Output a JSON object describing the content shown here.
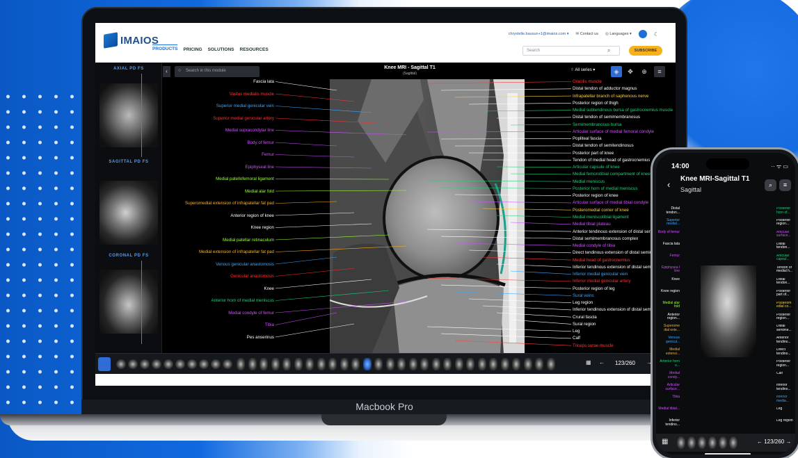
{
  "device": {
    "laptop_label": "Macbook Pro"
  },
  "header": {
    "logo": "IMAIOS",
    "nav": [
      "PRODUCTS",
      "PRICING",
      "SOLUTIONS",
      "RESOURCES"
    ],
    "account_email": "chrystelle.bausun+1@imaios.com ▾",
    "contact": "Contact us",
    "languages": "Languages ▾",
    "search_placeholder": "Search",
    "subscribe": "SUBSCRIBE"
  },
  "rail": {
    "series": [
      {
        "title": "AXIAL PD FS"
      },
      {
        "title": "SAGITTAL PD FS"
      },
      {
        "title": "CORONAL PD FS"
      }
    ]
  },
  "viewer": {
    "module_search_placeholder": "Search in this module",
    "title": "Knee MRI - Sagittal T1",
    "subtitle": "(Sagittal)",
    "series_selector": "All series ▾",
    "counter": "123/260",
    "labels_left": [
      {
        "text": "Fascia lata",
        "color": "#ffffff"
      },
      {
        "text": "Vastus medialis muscle",
        "color": "#ff3b3b"
      },
      {
        "text": "Superior medial genicular vein",
        "color": "#3aa8ff"
      },
      {
        "text": "Superior medial genicular artery",
        "color": "#ff3030"
      },
      {
        "text": "Medial supracondylar line",
        "color": "#d052ff"
      },
      {
        "text": "Body of femur",
        "color": "#d052ff"
      },
      {
        "text": "Femur",
        "color": "#d052ff"
      },
      {
        "text": "Epiphyseal line",
        "color": "#d052ff"
      },
      {
        "text": "Medial patellofemoral ligament",
        "color": "#9cff3a"
      },
      {
        "text": "Medial alar fold",
        "color": "#9cff3a"
      },
      {
        "text": "Superomedial extension of infrapatellar fat pad",
        "color": "#ffb020"
      },
      {
        "text": "Anterior region of knee",
        "color": "#ffffff"
      },
      {
        "text": "Knee region",
        "color": "#ffffff"
      },
      {
        "text": "Medial patellar retinaculum",
        "color": "#9cff3a"
      },
      {
        "text": "Medial extension of infrapatellar fat pad",
        "color": "#ffb020"
      },
      {
        "text": "Venous genicular anastomosis",
        "color": "#3aa8ff"
      },
      {
        "text": "Genicular anastomosis",
        "color": "#ff3030"
      },
      {
        "text": "Knee",
        "color": "#ffffff"
      },
      {
        "text": "Anterior horn of medial meniscus",
        "color": "#22d07a"
      },
      {
        "text": "Medial condyle of femur",
        "color": "#d052ff"
      },
      {
        "text": "Tibia",
        "color": "#d052ff"
      },
      {
        "text": "Pes anserinus",
        "color": "#ffffff"
      }
    ],
    "labels_right": [
      {
        "text": "Gracilis muscle",
        "color": "#ff3b3b"
      },
      {
        "text": "Distal tendon of adductor magnus",
        "color": "#ffffff"
      },
      {
        "text": "Infrapatellar branch of saphenous nerve",
        "color": "#ffd23a"
      },
      {
        "text": "Posterior region of thigh",
        "color": "#ffffff"
      },
      {
        "text": "Medial subtendinous bursa of gastrocnemius muscle",
        "color": "#22d07a"
      },
      {
        "text": "Distal tendon of semimembranosus",
        "color": "#ffffff"
      },
      {
        "text": "Semimembranosus bursa",
        "color": "#22d07a"
      },
      {
        "text": "Articular surface of medial femoral condyle",
        "color": "#d052ff"
      },
      {
        "text": "Popliteal fascia",
        "color": "#ffffff"
      },
      {
        "text": "Distal tendon of semitendinosus",
        "color": "#ffffff"
      },
      {
        "text": "Posterior part of knee",
        "color": "#ffffff"
      },
      {
        "text": "Tendon of medial head of gastrocnemius",
        "color": "#ffffff"
      },
      {
        "text": "Articular capsule of knee",
        "color": "#22d07a"
      },
      {
        "text": "Medial femorotibial compartment of knee joint",
        "color": "#22d07a"
      },
      {
        "text": "Medial meniscus",
        "color": "#22d07a"
      },
      {
        "text": "Posterior horn of medial meniscus",
        "color": "#22d07a"
      },
      {
        "text": "Posterior region of knee",
        "color": "#ffffff"
      },
      {
        "text": "Articular surface of medial tibial condyle",
        "color": "#d052ff"
      },
      {
        "text": "Posteromedial corner of knee",
        "color": "#ffd23a"
      },
      {
        "text": "Medial meniscotibial ligament",
        "color": "#22d07a"
      },
      {
        "text": "Medial tibial plateau",
        "color": "#d052ff"
      },
      {
        "text": "Anterior tendinous extension of distal semimembranosus complex",
        "color": "#ffffff"
      },
      {
        "text": "Distal semimembranosus complex",
        "color": "#ffffff"
      },
      {
        "text": "Medial condyle of tibia",
        "color": "#d052ff"
      },
      {
        "text": "Direct tendinous extension of distal semimembranosus complex",
        "color": "#ffffff"
      },
      {
        "text": "Medial head of gastrocnemius",
        "color": "#ff3b3b"
      },
      {
        "text": "Inferior tendinous extension of distal semimembranosus complex",
        "color": "#ffffff"
      },
      {
        "text": "Inferior medial genicular vein",
        "color": "#3aa8ff"
      },
      {
        "text": "Inferior medial genicular artery",
        "color": "#ff3030"
      },
      {
        "text": "Posterior region of leg",
        "color": "#ffffff"
      },
      {
        "text": "Sural veins",
        "color": "#3aa8ff"
      },
      {
        "text": "Leg region",
        "color": "#ffffff"
      },
      {
        "text": "Inferior tendinous extension of distal semimembranosus complex",
        "color": "#ffffff"
      },
      {
        "text": "Crural fascia",
        "color": "#ffffff"
      },
      {
        "text": "Sural region",
        "color": "#ffffff"
      },
      {
        "text": "Leg",
        "color": "#ffffff"
      },
      {
        "text": "Calf",
        "color": "#ffffff"
      },
      {
        "text": "Triceps surae muscle",
        "color": "#ff3b3b"
      }
    ]
  },
  "phone": {
    "time": "14:00",
    "title": "Knee MRI-Sagittal T1",
    "subtitle": "Sagittal",
    "counter": "123/260",
    "labels_left": [
      {
        "text": "Distal tendon...",
        "color": "#ffffff"
      },
      {
        "text": "Superior medial...",
        "color": "#3aa8ff"
      },
      {
        "text": "Body of femur",
        "color": "#d052ff"
      },
      {
        "text": "Fascia lata",
        "color": "#ffffff"
      },
      {
        "text": "Femur",
        "color": "#d052ff"
      },
      {
        "text": "Epiphysea l line",
        "color": "#d052ff"
      },
      {
        "text": "Knee",
        "color": "#ffffff"
      },
      {
        "text": "Knee region",
        "color": "#ffffff"
      },
      {
        "text": "Medial alar fold",
        "color": "#9cff3a"
      },
      {
        "text": "Anterior region...",
        "color": "#ffffff"
      },
      {
        "text": "Superome dial exte...",
        "color": "#ffb020"
      },
      {
        "text": "Venous genicul...",
        "color": "#3aa8ff"
      },
      {
        "text": "Medial extensi...",
        "color": "#ffb020"
      },
      {
        "text": "Anterior horn o...",
        "color": "#22d07a"
      },
      {
        "text": "Medial condy...",
        "color": "#d052ff"
      },
      {
        "text": "Articular surface...",
        "color": "#d052ff"
      },
      {
        "text": "Tibia",
        "color": "#d052ff"
      },
      {
        "text": "Medial tibial...",
        "color": "#d052ff"
      },
      {
        "text": "Inferior tendino...",
        "color": "#ffffff"
      }
    ],
    "labels_right": [
      {
        "text": "Posterior horn of...",
        "color": "#22d07a"
      },
      {
        "text": "Posterior region...",
        "color": "#ffffff"
      },
      {
        "text": "Articular surface...",
        "color": "#d052ff"
      },
      {
        "text": "Distal tendon...",
        "color": "#ffffff"
      },
      {
        "text": "Articular capsul...",
        "color": "#22d07a"
      },
      {
        "text": "Tendon of medial h...",
        "color": "#ffffff"
      },
      {
        "text": "Distal tendon...",
        "color": "#ffffff"
      },
      {
        "text": "Posterior part of...",
        "color": "#ffffff"
      },
      {
        "text": "Posterom edial co...",
        "color": "#ffd23a"
      },
      {
        "text": "Posterior region...",
        "color": "#ffffff"
      },
      {
        "text": "Distal semime...",
        "color": "#ffffff"
      },
      {
        "text": "Anterior tendino...",
        "color": "#ffffff"
      },
      {
        "text": "Direct tendino...",
        "color": "#ffffff"
      },
      {
        "text": "Posterior region...",
        "color": "#ffffff"
      },
      {
        "text": "Calf",
        "color": "#ffffff"
      },
      {
        "text": "Inferior tendino...",
        "color": "#ffffff"
      },
      {
        "text": "Inferior media...",
        "color": "#3aa8ff"
      },
      {
        "text": "Leg",
        "color": "#ffffff"
      },
      {
        "text": "Leg region",
        "color": "#ffffff"
      }
    ]
  }
}
